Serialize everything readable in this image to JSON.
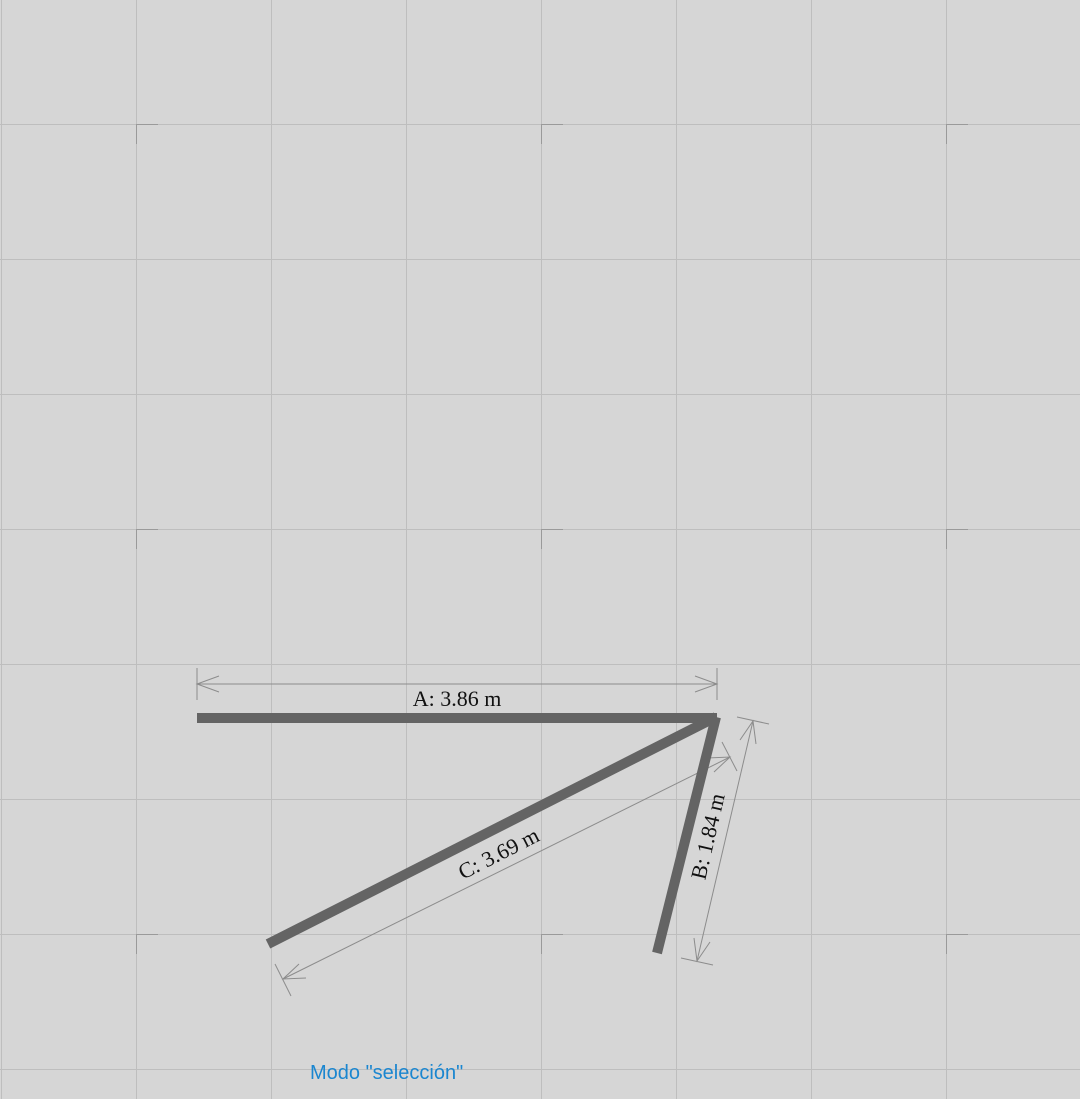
{
  "diagram": {
    "units": "m",
    "background_color": "#d6d6d6",
    "grid": true,
    "wall_color": "#646464",
    "walls": [
      {
        "id": "A",
        "label": "A: 3.86 m",
        "length_m": 3.86
      },
      {
        "id": "B",
        "label": "B: 1.84 m",
        "length_m": 1.84
      },
      {
        "id": "C",
        "label": "C: 3.69 m",
        "length_m": 3.69
      }
    ]
  },
  "status": {
    "mode_label": "Modo \"selección\"",
    "color": "#1a86d0"
  }
}
